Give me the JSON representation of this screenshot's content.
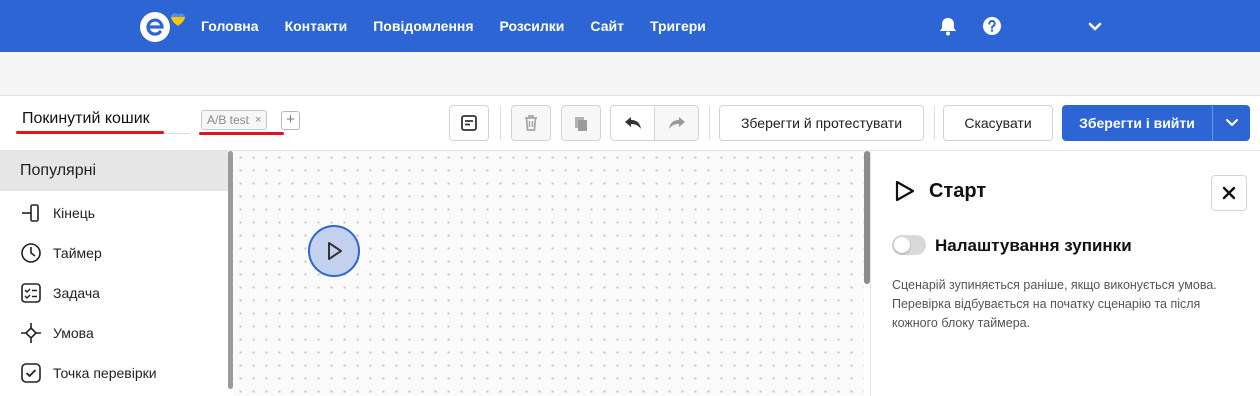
{
  "colors": {
    "brand": "#2e65d4",
    "accent_underline": "#e0141c"
  },
  "nav": {
    "items": [
      "Головна",
      "Контакти",
      "Повідомлення",
      "Розсилки",
      "Сайт",
      "Тригери"
    ],
    "icons": [
      "bell-icon",
      "help-icon",
      "chevron-down-icon"
    ]
  },
  "flow": {
    "name": "Покинутий кошик",
    "tag": "A/B test",
    "tag_remove": "×",
    "add_tag": "+"
  },
  "toolbar": {
    "save_test_label": "Зберегти й протестувати",
    "cancel_label": "Скасувати",
    "save_exit_label": "Зберегти і вийти"
  },
  "palette": {
    "header": "Популярні",
    "items": [
      {
        "label": "Кінець",
        "icon": "end-icon"
      },
      {
        "label": "Таймер",
        "icon": "timer-icon"
      },
      {
        "label": "Задача",
        "icon": "task-icon"
      },
      {
        "label": "Умова",
        "icon": "condition-icon"
      },
      {
        "label": "Точка перевірки",
        "icon": "checkpoint-icon"
      }
    ]
  },
  "panel": {
    "title": "Старт",
    "toggle_label": "Налаштування зупинки",
    "toggle_on": false,
    "description": "Сценарій зупиняється раніше, якщо виконується умова. Перевірка відбувається на початку сценарію та після кожного блоку таймера."
  }
}
